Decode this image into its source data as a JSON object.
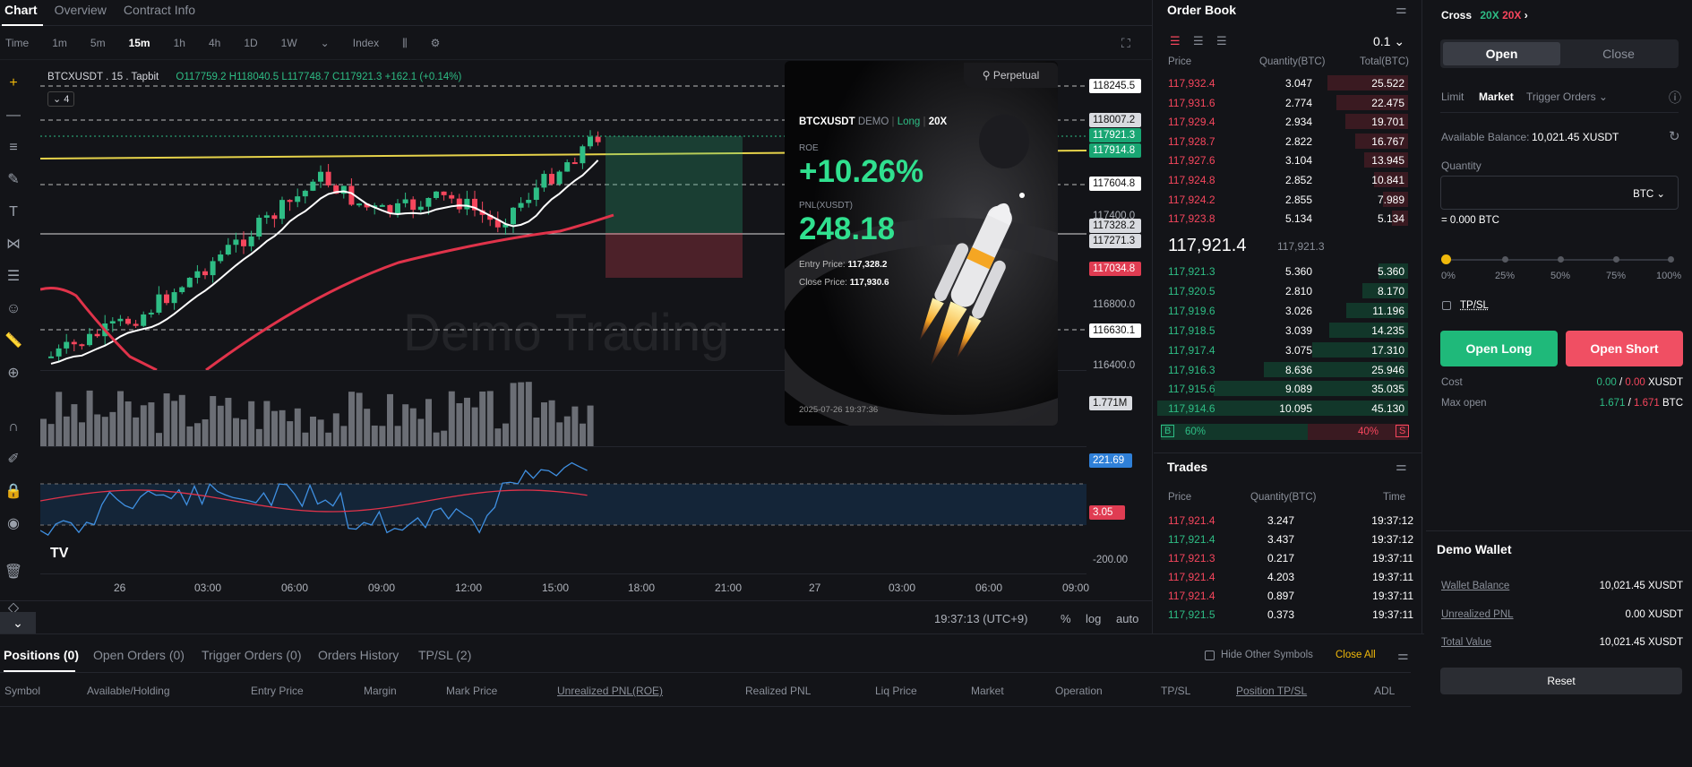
{
  "top_tabs": [
    "Chart",
    "Overview",
    "Contract Info"
  ],
  "timeframes": [
    "Time",
    "1m",
    "5m",
    "15m",
    "1h",
    "4h",
    "1D",
    "1W"
  ],
  "active_timeframe": "15m",
  "index_label": "Index",
  "symbol_line": "BTCXUSDT . 15 . Tapbit",
  "ohlc": {
    "o": "O117759.2",
    "h": "H118040.5",
    "l": "L117748.7",
    "c": "C117921.3",
    "chg": "+162.1 (+0.14%)"
  },
  "collapse_count": "4",
  "watermark": "Demo Trading",
  "price_labels": {
    "p1": "118245.5",
    "p2": "118007.2",
    "p3": "117921.3",
    "p4": "117914.8",
    "p5": "117604.8",
    "p6": "117400.0",
    "p7": "117328.2",
    "p8": "117271.3",
    "p9": "117034.8",
    "p10": "116800.0",
    "p11": "116630.1",
    "p12": "116400.0",
    "vol": "1.771M",
    "rsi1": "221.69",
    "rsi2": "3.05",
    "rsi3": "-200.00"
  },
  "time_axis": [
    "26",
    "03:00",
    "06:00",
    "09:00",
    "12:00",
    "15:00",
    "18:00",
    "21:00",
    "27",
    "03:00",
    "06:00",
    "09:00"
  ],
  "footer": {
    "clock": "19:37:13 (UTC+9)",
    "pct": "%",
    "log": "log",
    "auto": "auto"
  },
  "pnl_card": {
    "tag": "Perpetual",
    "symbol": "BTCXUSDT",
    "demo": "DEMO",
    "side": "Long",
    "lev": "20X",
    "roe_label": "ROE",
    "roe": "+10.26%",
    "pnl_label": "PNL(XUSDT)",
    "pnl": "248.18",
    "entry_label": "Entry Price:",
    "entry": "117,328.2",
    "close_label": "Close Price:",
    "close": "117,930.6",
    "timestamp": "2025-07-26 19:37:36"
  },
  "orderbook": {
    "title": "Order Book",
    "precision": "0.1",
    "headers": [
      "Price",
      "Quantity(BTC)",
      "Total(BTC)"
    ],
    "asks": [
      [
        "117,932.4",
        "3.047",
        "25.522"
      ],
      [
        "117,931.6",
        "2.774",
        "22.475"
      ],
      [
        "117,929.4",
        "2.934",
        "19.701"
      ],
      [
        "117,928.7",
        "2.822",
        "16.767"
      ],
      [
        "117,927.6",
        "3.104",
        "13.945"
      ],
      [
        "117,924.8",
        "2.852",
        "10.841"
      ],
      [
        "117,924.2",
        "2.855",
        "7.989"
      ],
      [
        "117,923.8",
        "5.134",
        "5.134"
      ]
    ],
    "last_price": "117,921.4",
    "mark_price": "117,921.3",
    "bids": [
      [
        "117,921.3",
        "5.360",
        "5.360"
      ],
      [
        "117,920.5",
        "2.810",
        "8.170"
      ],
      [
        "117,919.6",
        "3.026",
        "11.196"
      ],
      [
        "117,918.5",
        "3.039",
        "14.235"
      ],
      [
        "117,917.4",
        "3.075",
        "17.310"
      ],
      [
        "117,916.3",
        "8.636",
        "25.946"
      ],
      [
        "117,915.6",
        "9.089",
        "35.035"
      ],
      [
        "117,914.6",
        "10.095",
        "45.130"
      ]
    ],
    "buy_label": "B",
    "buy_pct": "60%",
    "sell_pct": "40%",
    "sell_label": "S"
  },
  "trades": {
    "title": "Trades",
    "headers": [
      "Price",
      "Quantity(BTC)",
      "Time"
    ],
    "rows": [
      [
        "117,921.4",
        "3.247",
        "19:37:12",
        "red"
      ],
      [
        "117,921.4",
        "3.437",
        "19:37:12",
        "green"
      ],
      [
        "117,921.3",
        "0.217",
        "19:37:11",
        "red"
      ],
      [
        "117,921.4",
        "4.203",
        "19:37:11",
        "red"
      ],
      [
        "117,921.4",
        "0.897",
        "19:37:11",
        "red"
      ],
      [
        "117,921.5",
        "0.373",
        "19:37:11",
        "green"
      ]
    ]
  },
  "trade_panel": {
    "cross": "Cross",
    "lev_long": "20X",
    "lev_short": "20X",
    "open": "Open",
    "close": "Close",
    "order_types": [
      "Limit",
      "Market",
      "Trigger Orders"
    ],
    "avail_label": "Available Balance:",
    "avail": "10,021.45 XUSDT",
    "qty_label": "Quantity",
    "qty_unit": "BTC",
    "qty_value": "= 0.000 BTC",
    "slider_marks": [
      "0%",
      "25%",
      "50%",
      "75%",
      "100%"
    ],
    "tpsl": "TP/SL",
    "open_long": "Open Long",
    "open_short": "Open Short",
    "cost_label": "Cost",
    "cost_long": "0.00",
    "cost_short": "0.00",
    "cost_unit": "XUSDT",
    "max_label": "Max open",
    "max_long": "1.671",
    "max_short": "1.671",
    "max_unit": "BTC"
  },
  "wallet": {
    "title": "Demo Wallet",
    "balance_label": "Wallet Balance",
    "balance": "10,021.45 XUSDT",
    "upnl_label": "Unrealized PNL",
    "upnl": "0.00 XUSDT",
    "total_label": "Total Value",
    "total": "10,021.45 XUSDT",
    "reset": "Reset"
  },
  "bottom": {
    "tabs": [
      "Positions (0)",
      "Open Orders (0)",
      "Trigger Orders (0)",
      "Orders History",
      "TP/SL (2)"
    ],
    "hide_other": "Hide Other Symbols",
    "close_all": "Close All",
    "columns": [
      "Symbol",
      "Available/Holding",
      "Entry Price",
      "Margin",
      "Mark Price",
      "Unrealized PNL(ROE)",
      "Realized PNL",
      "Liq Price",
      "Market",
      "Operation",
      "TP/SL",
      "Position TP/SL",
      "ADL"
    ]
  },
  "colors": {
    "up": "#2ebd85",
    "down": "#f6465d",
    "accent": "#f0b90b"
  }
}
